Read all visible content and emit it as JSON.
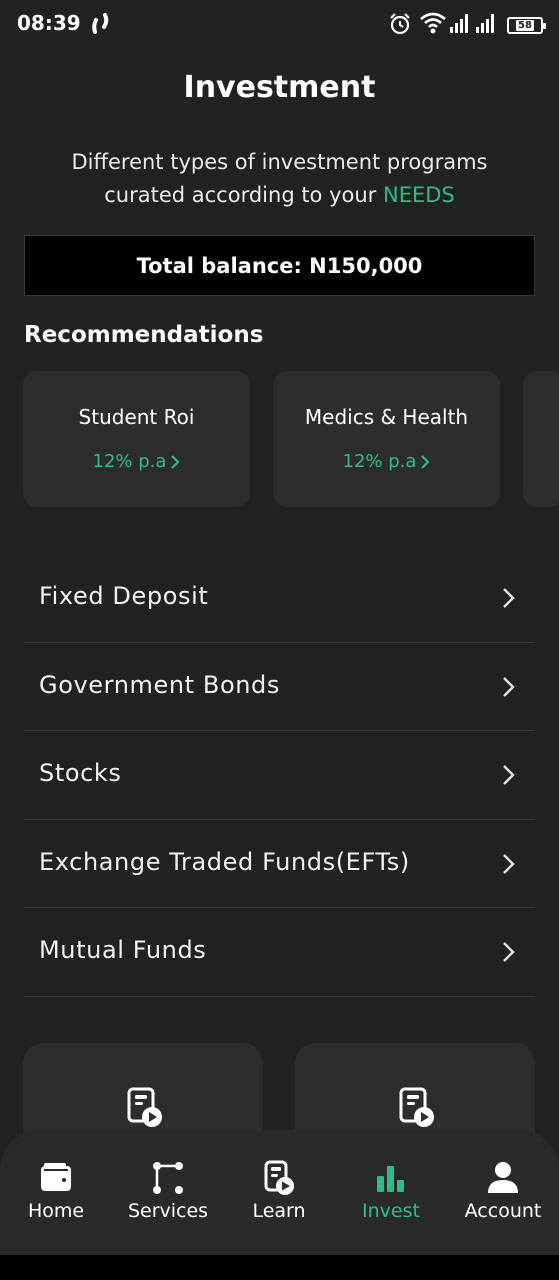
{
  "status": {
    "time": "08:39",
    "battery": "58"
  },
  "header": {
    "title": "Investment",
    "subtitle_main": "Different types of investment programs curated according to your ",
    "subtitle_accent": "NEEDS"
  },
  "balance": {
    "label": "Total balance: N150,000"
  },
  "recommendations": {
    "title": "Recommendations",
    "cards": [
      {
        "name": "Student Roi",
        "rate": "12% p.a"
      },
      {
        "name": "Medics & Health",
        "rate": "12% p.a"
      }
    ]
  },
  "investments": [
    {
      "label": "Fixed Deposit"
    },
    {
      "label": "Government Bonds"
    },
    {
      "label": "Stocks"
    },
    {
      "label": "Exchange Traded Funds(EFTs)"
    },
    {
      "label": "Mutual Funds"
    }
  ],
  "nav": {
    "items": [
      {
        "label": "Home",
        "icon": "wallet-icon"
      },
      {
        "label": "Services",
        "icon": "nodes-icon"
      },
      {
        "label": "Learn",
        "icon": "doc-play-icon"
      },
      {
        "label": "Invest",
        "icon": "bar-chart-icon"
      },
      {
        "label": "Account",
        "icon": "user-icon"
      }
    ],
    "active": "Invest"
  },
  "colors": {
    "accent": "#2ebd85",
    "background": "#222222",
    "card": "#2d2d2d"
  }
}
